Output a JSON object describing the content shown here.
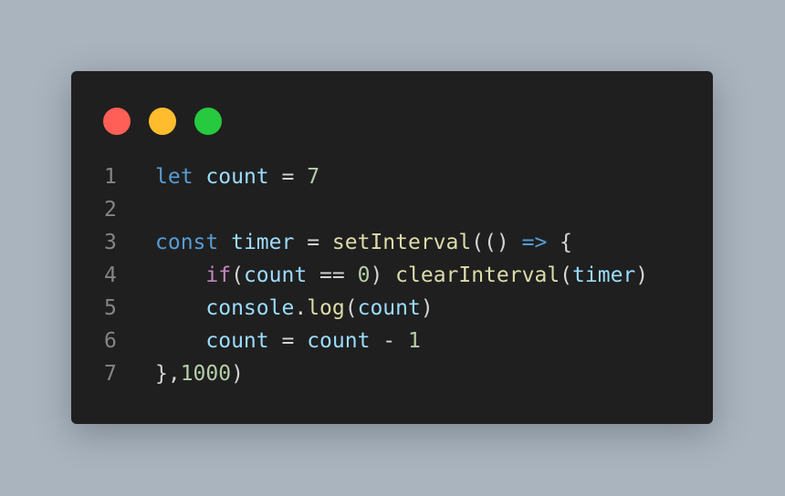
{
  "window": {
    "controls": [
      {
        "name": "close-dot",
        "color": "#ff5f56"
      },
      {
        "name": "minimize-dot",
        "color": "#ffbd2e"
      },
      {
        "name": "maximize-dot",
        "color": "#27c93f"
      }
    ]
  },
  "colors": {
    "keyword": "#569cd6",
    "variable": "#9cdcfe",
    "operator": "#d4d4d4",
    "number": "#b5cea8",
    "function": "#dcdcaa",
    "control": "#c586c0",
    "line_number": "#858585",
    "background": "#1f1f1f"
  },
  "code": {
    "lines": [
      {
        "number": "1",
        "tokens": [
          {
            "text": "let",
            "type": "keyword"
          },
          {
            "text": " ",
            "type": "operator"
          },
          {
            "text": "count",
            "type": "variable"
          },
          {
            "text": " = ",
            "type": "operator"
          },
          {
            "text": "7",
            "type": "number"
          }
        ]
      },
      {
        "number": "2",
        "tokens": []
      },
      {
        "number": "3",
        "tokens": [
          {
            "text": "const",
            "type": "keyword"
          },
          {
            "text": " ",
            "type": "operator"
          },
          {
            "text": "timer",
            "type": "variable"
          },
          {
            "text": " = ",
            "type": "operator"
          },
          {
            "text": "setInterval",
            "type": "function"
          },
          {
            "text": "(() ",
            "type": "operator"
          },
          {
            "text": "=>",
            "type": "keyword"
          },
          {
            "text": " {",
            "type": "operator"
          }
        ]
      },
      {
        "number": "4",
        "tokens": [
          {
            "text": "    ",
            "type": "operator"
          },
          {
            "text": "if",
            "type": "control"
          },
          {
            "text": "(",
            "type": "operator"
          },
          {
            "text": "count",
            "type": "variable"
          },
          {
            "text": " == ",
            "type": "operator"
          },
          {
            "text": "0",
            "type": "number"
          },
          {
            "text": ") ",
            "type": "operator"
          },
          {
            "text": "clearInterval",
            "type": "function"
          },
          {
            "text": "(",
            "type": "operator"
          },
          {
            "text": "timer",
            "type": "variable"
          },
          {
            "text": ")",
            "type": "operator"
          }
        ]
      },
      {
        "number": "5",
        "tokens": [
          {
            "text": "    ",
            "type": "operator"
          },
          {
            "text": "console",
            "type": "variable"
          },
          {
            "text": ".",
            "type": "operator"
          },
          {
            "text": "log",
            "type": "function"
          },
          {
            "text": "(",
            "type": "operator"
          },
          {
            "text": "count",
            "type": "variable"
          },
          {
            "text": ")",
            "type": "operator"
          }
        ]
      },
      {
        "number": "6",
        "tokens": [
          {
            "text": "    ",
            "type": "operator"
          },
          {
            "text": "count",
            "type": "variable"
          },
          {
            "text": " = ",
            "type": "operator"
          },
          {
            "text": "count",
            "type": "variable"
          },
          {
            "text": " - ",
            "type": "operator"
          },
          {
            "text": "1",
            "type": "number"
          }
        ]
      },
      {
        "number": "7",
        "tokens": [
          {
            "text": "},",
            "type": "operator"
          },
          {
            "text": "1000",
            "type": "number"
          },
          {
            "text": ")",
            "type": "operator"
          }
        ]
      }
    ]
  }
}
